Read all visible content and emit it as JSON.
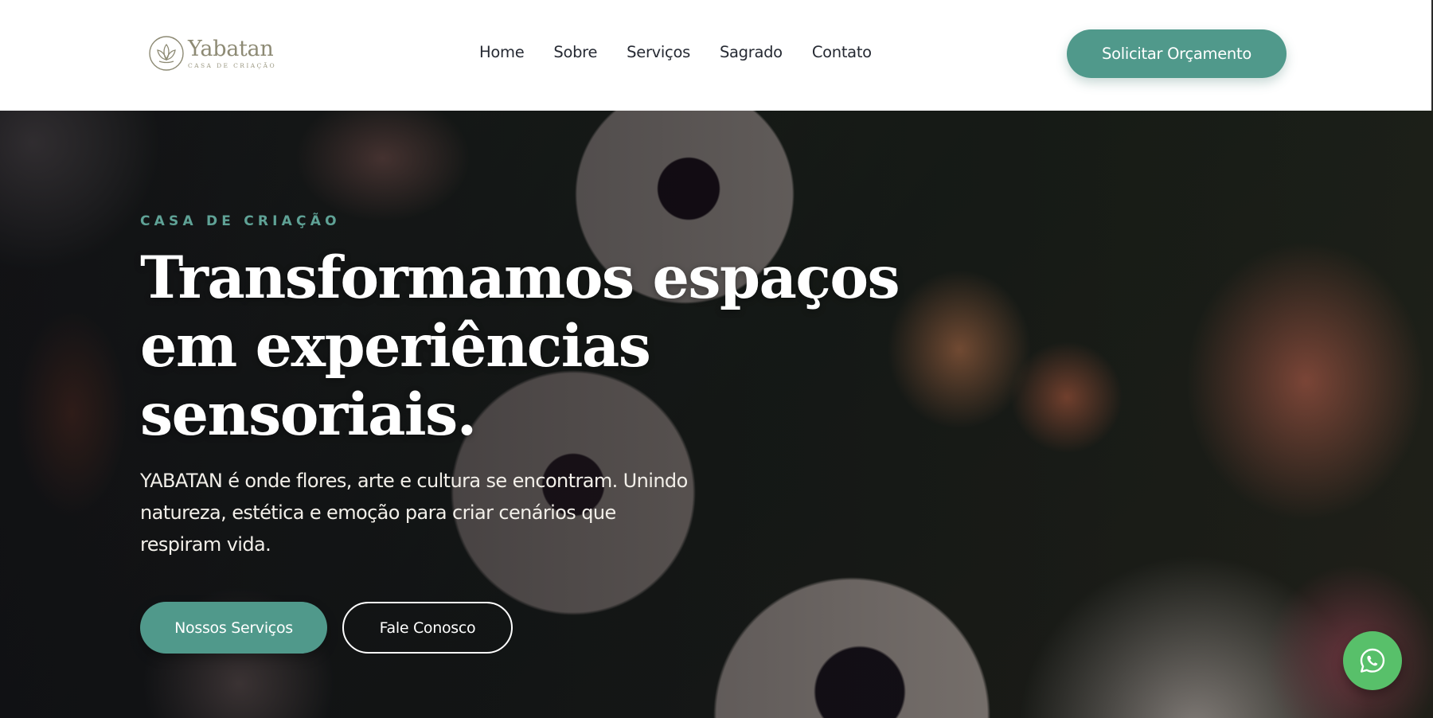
{
  "brand": {
    "name": "Yabatan",
    "tagline": "CASA DE CRIAÇÃO"
  },
  "nav": {
    "items": [
      {
        "label": "Home"
      },
      {
        "label": "Sobre"
      },
      {
        "label": "Serviços"
      },
      {
        "label": "Sagrado"
      },
      {
        "label": "Contato"
      }
    ],
    "cta_label": "Solicitar Orçamento"
  },
  "hero": {
    "eyebrow": "CASA DE CRIAÇÃO",
    "headline_lines": [
      "Transformamos espaços",
      "em experiências",
      "sensoriais."
    ],
    "lead_lines": [
      "YABATAN é onde flores, arte e cultura se encontram. Unindo",
      "natureza, estética e emoção para criar cenários que",
      "respiram vida."
    ],
    "primary_button": "Nossos Serviços",
    "secondary_button": "Fale Conosco"
  },
  "floating": {
    "icon": "whatsapp-icon"
  },
  "colors": {
    "accent": "#50998b",
    "eyebrow": "#5fa296",
    "logo": "#8d8a74",
    "nav_text": "#262a33",
    "whatsapp": "#58c06a"
  }
}
